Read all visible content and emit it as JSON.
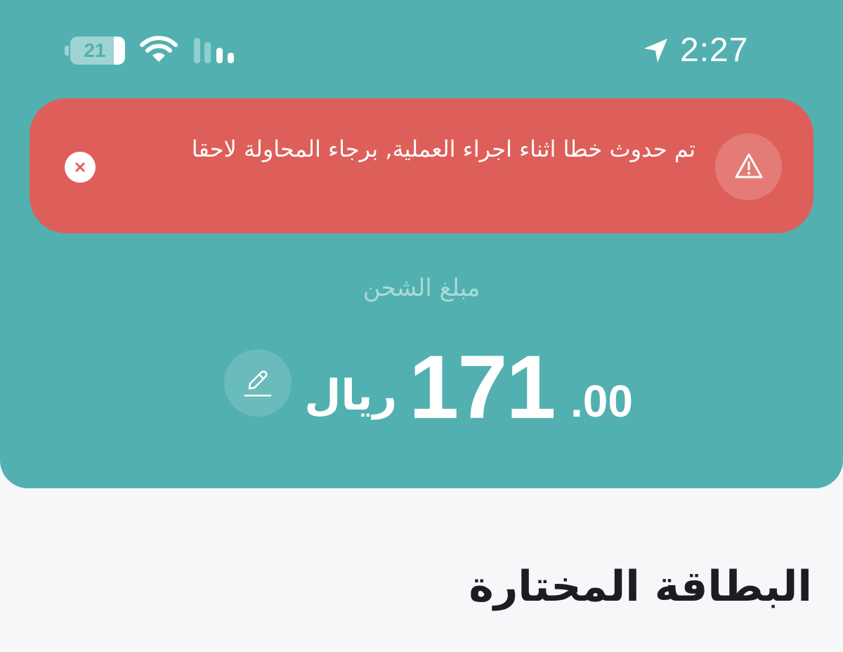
{
  "status_bar": {
    "battery_level": "21",
    "battery_fill_percent": 21,
    "time": "2:27",
    "wifi_icon": "wifi-icon",
    "signal_icon": "cellular-signal-icon",
    "location_icon": "location-arrow-icon"
  },
  "error_banner": {
    "message": "تم حدوث خطا اثناء اجراء العملية, برجاء المحاولة لاحقا",
    "close_icon": "close-icon",
    "warning_icon": "warning-triangle-icon",
    "background_color": "#de5f5a"
  },
  "charge": {
    "label": "مبلغ الشحن",
    "amount_integer": "171",
    "amount_decimal": ".00",
    "currency": "ريال",
    "edit_icon": "pencil-edit-icon"
  },
  "selected_card": {
    "title": "البطاقة المختارة"
  },
  "colors": {
    "header_bg": "#52b0b0",
    "page_bg": "#f6f7f9",
    "text_dark": "#1b1d22"
  }
}
